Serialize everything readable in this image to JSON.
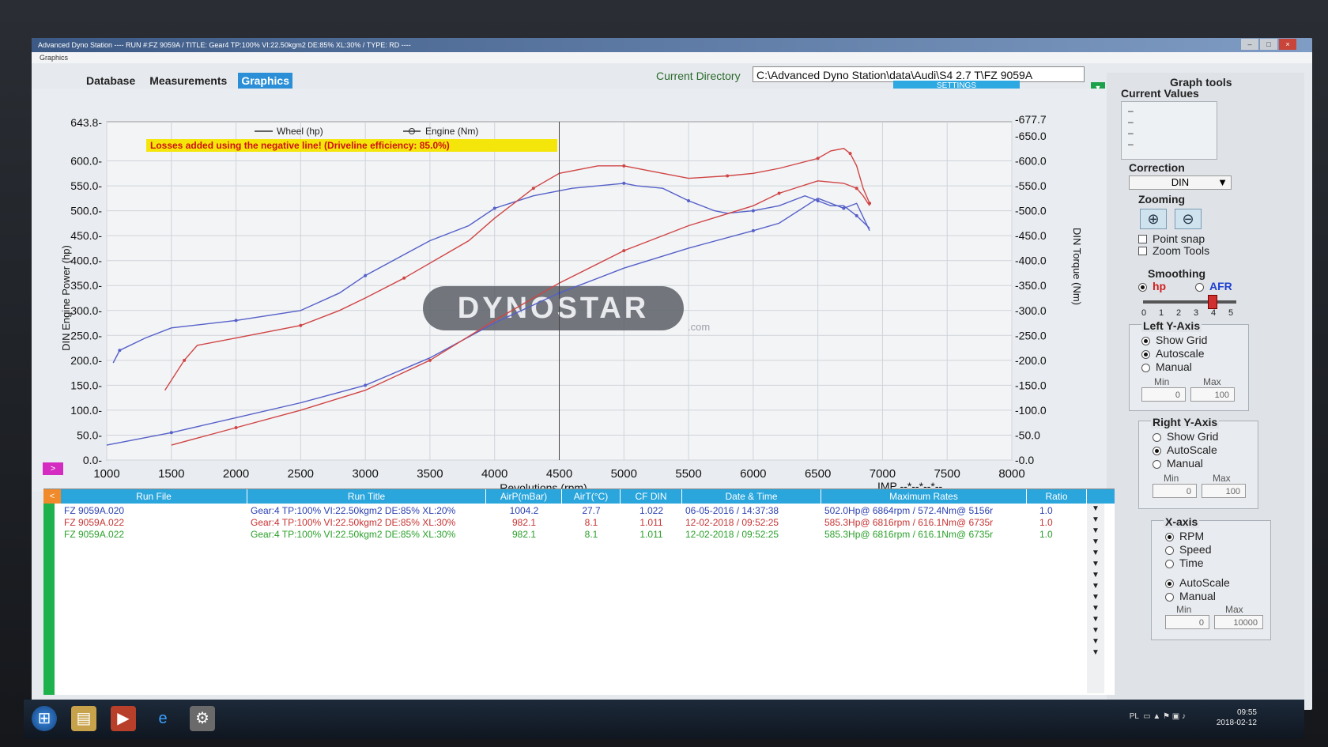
{
  "window": {
    "title": "Advanced Dyno Station ---- RUN #:FZ 9059A / TITLE: Gear4 TP:100% VI:22.50kgm2 DE:85% XL:30% / TYPE: RD ----",
    "menu": "Graphics"
  },
  "tabs": [
    {
      "label": "Database"
    },
    {
      "label": "Measurements"
    },
    {
      "label": "Graphics"
    }
  ],
  "current_directory": {
    "label": "Current Directory",
    "value": "C:\\Advanced Dyno Station\\data\\Audi\\S4 2.7 T\\FZ 9059A"
  },
  "settings_label": "SETTINGS",
  "chart_data": {
    "type": "line",
    "left_top_value": "643.8",
    "right_top_value": "677.7",
    "banner": "Losses added using the negative line! (Driveline efficiency: 85.0%)",
    "legend": [
      "Wheel  (hp)",
      "Engine (Nm)"
    ],
    "watermark": "DYNOSTAR",
    "watermark_sub": ".com",
    "xlabel": "Revolutions (rpm)",
    "ylabel_left": "DIN Engine Power (hp)",
    "ylabel_right": "DIN Torque (Nm)",
    "imp_label": "IMP --*--*--*--",
    "xlim": [
      1000,
      8000
    ],
    "ylim_left": [
      0,
      650
    ],
    "ylim_right": [
      0,
      650
    ],
    "x_ticks": [
      "1000",
      "1500",
      "2000",
      "2500",
      "3000",
      "3500",
      "4000",
      "4500",
      "5000",
      "5500",
      "6000",
      "6500",
      "7000",
      "7500",
      "8000"
    ],
    "y_ticks_left": [
      "0.0",
      "50.0",
      "100.0",
      "150.0",
      "200.0",
      "250.0",
      "300.0",
      "350.0",
      "400.0",
      "450.0",
      "500.0",
      "550.0",
      "600.0"
    ],
    "y_ticks_right": [
      "-0.0",
      "-50.0",
      "-100.0",
      "-150.0",
      "-200.0",
      "-250.0",
      "-300.0",
      "-350.0",
      "-400.0",
      "-450.0",
      "-500.0",
      "-550.0",
      "-600.0",
      "-650.0"
    ],
    "cursor_x": 4500,
    "series": [
      {
        "color": "#5560c8",
        "axis": "right",
        "x": [
          1050,
          1100,
          1300,
          1500,
          2000,
          2500,
          2800,
          3000,
          3500,
          3800,
          4000,
          4300,
          4600,
          5000,
          5100,
          5300,
          5500,
          5700,
          5800,
          6000,
          6200,
          6400,
          6500,
          6600,
          6700,
          6800,
          6900
        ],
        "y": [
          195,
          220,
          245,
          265,
          280,
          300,
          335,
          370,
          440,
          470,
          505,
          530,
          545,
          555,
          550,
          545,
          520,
          500,
          495,
          500,
          510,
          530,
          520,
          510,
          510,
          490,
          465
        ]
      },
      {
        "color": "#d04545",
        "axis": "right",
        "x": [
          1450,
          1600,
          1700,
          2000,
          2500,
          2800,
          3000,
          3300,
          3800,
          4000,
          4300,
          4500,
          4800,
          5000,
          5200,
          5500,
          5800,
          6000,
          6200,
          6500,
          6600,
          6700,
          6750,
          6800,
          6850,
          6900
        ],
        "y": [
          140,
          200,
          230,
          245,
          270,
          300,
          325,
          365,
          440,
          485,
          545,
          575,
          590,
          590,
          580,
          565,
          570,
          575,
          585,
          605,
          620,
          625,
          615,
          590,
          545,
          515
        ]
      },
      {
        "color": "#5560c8",
        "axis": "left",
        "x": [
          1000,
          1500,
          2000,
          2500,
          3000,
          3500,
          4000,
          4500,
          5000,
          5500,
          6000,
          6200,
          6500,
          6700,
          6800,
          6900
        ],
        "y": [
          30,
          55,
          85,
          115,
          150,
          205,
          275,
          335,
          385,
          425,
          460,
          475,
          525,
          505,
          515,
          460
        ]
      },
      {
        "color": "#d04545",
        "axis": "left",
        "x": [
          1500,
          2000,
          2500,
          3000,
          3500,
          4000,
          4500,
          5000,
          5500,
          6000,
          6200,
          6500,
          6700,
          6800,
          6850,
          6900
        ],
        "y": [
          30,
          65,
          100,
          140,
          200,
          280,
          355,
          420,
          470,
          510,
          535,
          560,
          555,
          545,
          530,
          510
        ]
      }
    ]
  },
  "panel": {
    "graph_tools": "Graph tools",
    "current_values": "Current Values",
    "correction_label": "Correction",
    "correction_value": "DIN",
    "zooming_label": "Zooming",
    "point_snap": "Point snap",
    "zoom_tools": "Zoom Tools",
    "smoothing_label": "Smoothing",
    "smooth_hp": "hp",
    "smooth_afr": "AFR",
    "slider_ticks": [
      "0",
      "1",
      "2",
      "3",
      "4",
      "5"
    ],
    "slider_value": 4,
    "left_y": {
      "title": "Left Y-Axis",
      "show_grid": "Show Grid",
      "autoscale": "Autoscale",
      "manual": "Manual",
      "min_label": "Min",
      "max_label": "Max",
      "min": "0",
      "max": "100"
    },
    "right_y": {
      "title": "Right Y-Axis",
      "show_grid": "Show Grid",
      "autoscale": "AutoScale",
      "manual": "Manual",
      "min_label": "Min",
      "max_label": "Max",
      "min": "0",
      "max": "100"
    },
    "x_axis": {
      "title": "X-axis",
      "rpm": "RPM",
      "speed": "Speed",
      "time": "Time",
      "autoscale": "AutoScale",
      "manual": "Manual",
      "min_label": "Min",
      "max_label": "Max",
      "min": "0",
      "max": "10000"
    }
  },
  "table": {
    "headers": [
      "Run File",
      "Run Title",
      "AirP(mBar)",
      "AirT(°C)",
      "CF DIN",
      "Date & Time",
      "Maximum Rates",
      "Ratio"
    ],
    "rows": [
      {
        "file": "FZ 9059A.020",
        "title": "Gear:4 TP:100% VI:22.50kgm2 DE:85% XL:20%",
        "airp": "1004.2",
        "airt": "27.7",
        "cf": "1.022",
        "date": "06-05-2016 / 14:37:38",
        "max": "502.0Hp@ 6864rpm / 572.4Nm@ 5156r",
        "ratio": "1.0",
        "color": "#2a3fb0"
      },
      {
        "file": "FZ 9059A.022",
        "title": "Gear:4 TP:100% VI:22.50kgm2 DE:85% XL:30%",
        "airp": "982.1",
        "airt": "8.1",
        "cf": "1.011",
        "date": "12-02-2018 / 09:52:25",
        "max": "585.3Hp@ 6816rpm / 616.1Nm@ 6735r",
        "ratio": "1.0",
        "color": "#c83232"
      },
      {
        "file": "FZ 9059A.022",
        "title": "Gear:4 TP:100% VI:22.50kgm2 DE:85% XL:30%",
        "airp": "982.1",
        "airt": "8.1",
        "cf": "1.011",
        "date": "12-02-2018 / 09:52:25",
        "max": "585.3Hp@ 6816rpm / 616.1Nm@ 6735r",
        "ratio": "1.0",
        "color": "#2aa02a"
      }
    ]
  },
  "taskbar": {
    "lang": "PL",
    "time": "09:55",
    "date": "2018-02-12"
  }
}
